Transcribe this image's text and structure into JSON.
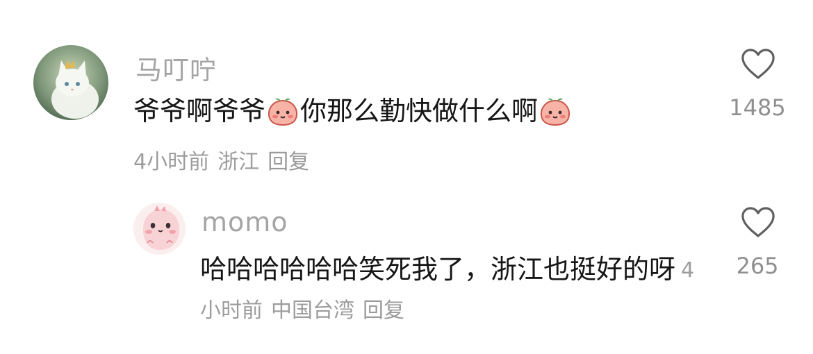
{
  "comments": [
    {
      "username": "马叮咛",
      "text_part1": "爷爷啊爷爷",
      "text_part2": "你那么勤快做什么啊",
      "emoji": "peach-face-emoji",
      "time": "4小时前",
      "location": "浙江",
      "reply_label": "回复",
      "likes": "1485",
      "avatar": "white-cat-with-crown-avatar"
    },
    {
      "username": "momo",
      "text": "哈哈哈哈哈哈笑死我了，浙江也挺好的呀",
      "time": "4小时前",
      "location": "中国台湾",
      "reply_label": "回复",
      "likes": "265",
      "avatar": "pink-dinosaur-avatar"
    }
  ],
  "colors": {
    "username": "#a4a4a4",
    "content": "#161616",
    "meta": "#9c9c9c",
    "icon": "#5f5f5f"
  }
}
